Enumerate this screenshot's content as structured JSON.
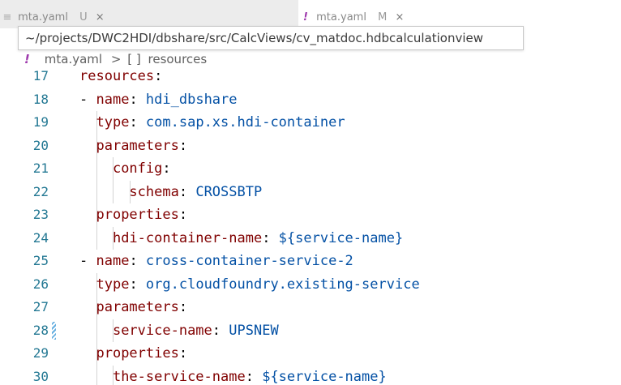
{
  "tabs": [
    {
      "icon": "yaml",
      "label": "mta.yaml",
      "modified_mark": "U",
      "close": "×",
      "active": false
    },
    {
      "icon": "!",
      "label": "mta.yaml",
      "modified_mark": "M",
      "close": "×",
      "active": true
    }
  ],
  "tooltip": {
    "path": "~/projects/DWC2HDI/dbshare/src/CalcViews/cv_matdoc.hdbcalculationview"
  },
  "breadcrumb": {
    "file_icon": "!",
    "file": "mta.yaml",
    "separator": ">",
    "symbol_icon": "[ ]",
    "symbol": "resources"
  },
  "editor": {
    "lines": [
      {
        "n": "17",
        "indent": "",
        "dash": "",
        "key": "resources",
        "colon": ":",
        "value": ""
      },
      {
        "n": "18",
        "indent": "",
        "dash": "- ",
        "key": "name",
        "colon": ": ",
        "value": "hdi_dbshare"
      },
      {
        "n": "19",
        "indent": "  ",
        "dash": "",
        "key": "type",
        "colon": ": ",
        "value": "com.sap.xs.hdi-container"
      },
      {
        "n": "20",
        "indent": "  ",
        "dash": "",
        "key": "parameters",
        "colon": ":",
        "value": ""
      },
      {
        "n": "21",
        "indent": "    ",
        "dash": "",
        "key": "config",
        "colon": ":",
        "value": ""
      },
      {
        "n": "22",
        "indent": "      ",
        "dash": "",
        "key": "schema",
        "colon": ": ",
        "value": "CROSSBTP"
      },
      {
        "n": "23",
        "indent": "  ",
        "dash": "",
        "key": "properties",
        "colon": ":",
        "value": ""
      },
      {
        "n": "24",
        "indent": "    ",
        "dash": "",
        "key": "hdi-container-name",
        "colon": ": ",
        "value": "${service-name}"
      },
      {
        "n": "25",
        "indent": "",
        "dash": "- ",
        "key": "name",
        "colon": ": ",
        "value": "cross-container-service-2"
      },
      {
        "n": "26",
        "indent": "  ",
        "dash": "",
        "key": "type",
        "colon": ": ",
        "value": "org.cloudfoundry.existing-service"
      },
      {
        "n": "27",
        "indent": "  ",
        "dash": "",
        "key": "parameters",
        "colon": ":",
        "value": ""
      },
      {
        "n": "28",
        "indent": "    ",
        "dash": "",
        "key": "service-name",
        "colon": ": ",
        "value": "UPSNEW"
      },
      {
        "n": "29",
        "indent": "  ",
        "dash": "",
        "key": "properties",
        "colon": ":",
        "value": ""
      },
      {
        "n": "30",
        "indent": "    ",
        "dash": "",
        "key": "the-service-name",
        "colon": ": ",
        "value": "${service-name}"
      }
    ]
  },
  "colors": {
    "key": "#800000",
    "value": "#0451a5",
    "line_number": "#237893",
    "modified_gutter": "#66afe0",
    "yaml_icon": "#9e3aad"
  }
}
